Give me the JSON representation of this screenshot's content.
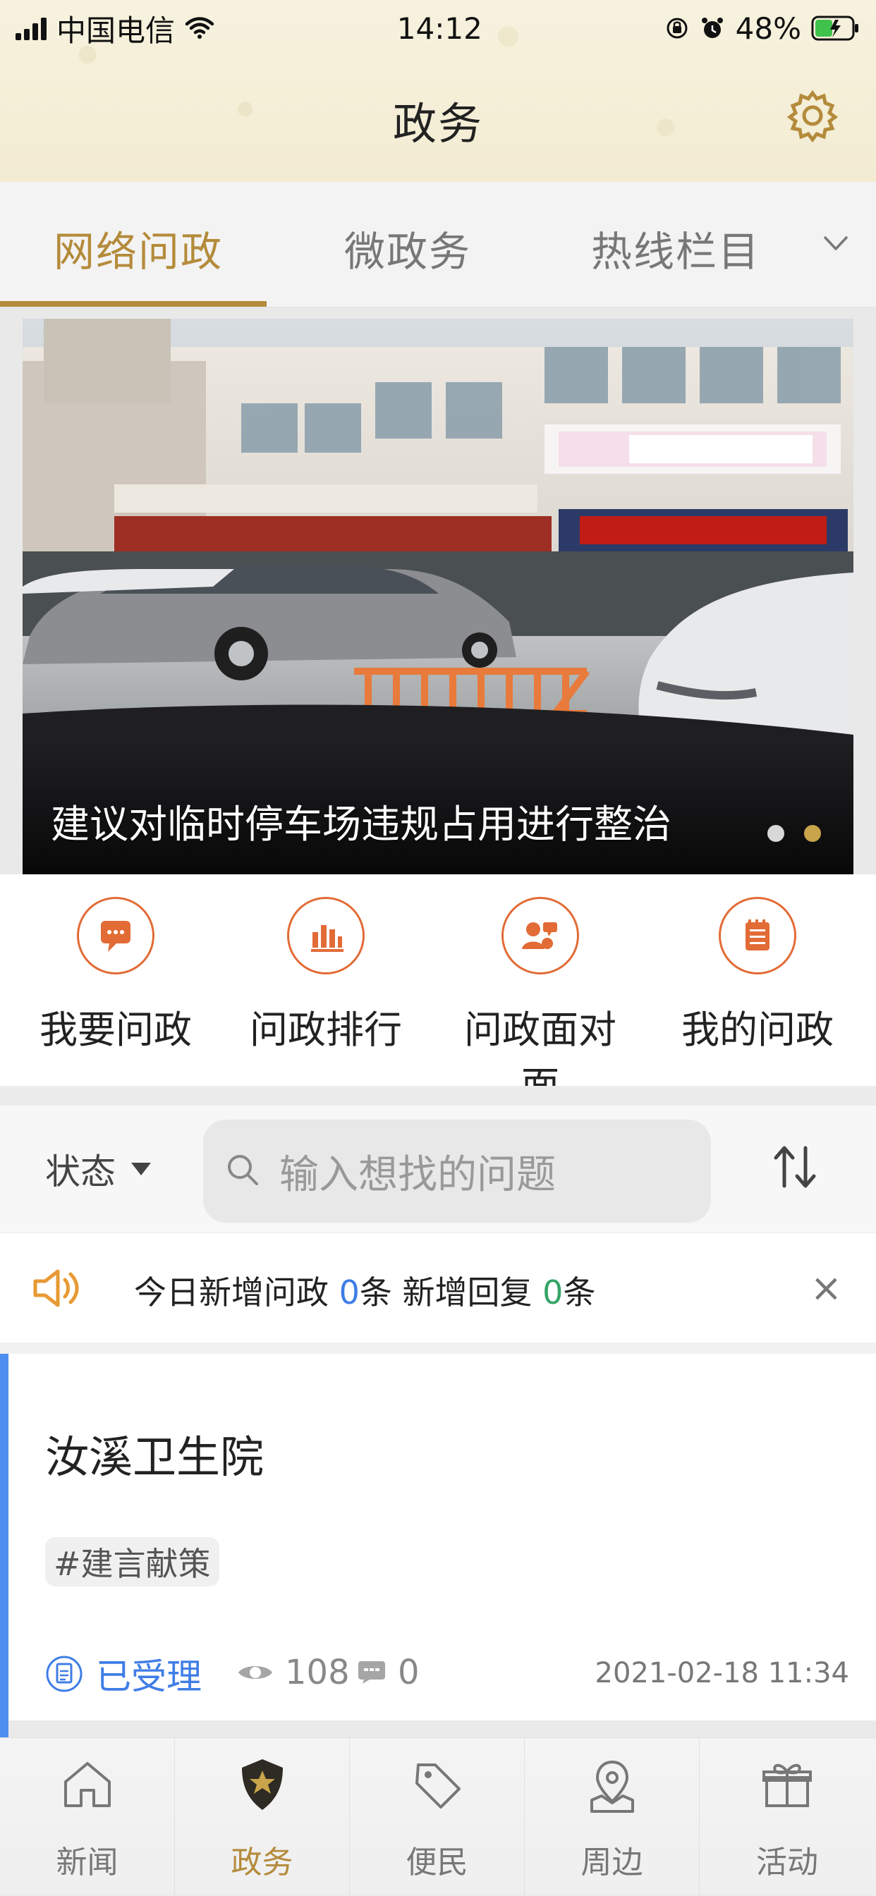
{
  "status_bar": {
    "carrier": "中国电信",
    "time": "14:12",
    "battery": "48%"
  },
  "header": {
    "title": "政务"
  },
  "tabs": [
    {
      "label": "网络问政",
      "active": true
    },
    {
      "label": "微政务",
      "active": false
    },
    {
      "label": "热线栏目",
      "active": false
    }
  ],
  "banner": {
    "caption": "建议对临时停车场违规占用进行整治",
    "page_index": 2,
    "page_count": 2
  },
  "quick_actions": [
    {
      "label": "我要问政",
      "icon": "chat-icon"
    },
    {
      "label": "问政排行",
      "icon": "chart-icon"
    },
    {
      "label": "问政面对面",
      "icon": "face-to-face-icon"
    },
    {
      "label": "我的问政",
      "icon": "notepad-icon"
    }
  ],
  "filter": {
    "status_label": "状态",
    "search_placeholder": "输入想找的问题"
  },
  "notice": {
    "prefix": "今日新增问政 ",
    "new_questions": "0",
    "middle": "条 新增回复 ",
    "new_replies": "0",
    "suffix": "条",
    "close": "×"
  },
  "feed": [
    {
      "title": "汝溪卫生院",
      "tag": "#建言献策",
      "status": "已受理",
      "views": "108",
      "comments": "0",
      "date": "2021-02-18 11:34"
    }
  ],
  "bottom_nav": [
    {
      "label": "新闻",
      "active": false
    },
    {
      "label": "政务",
      "active": true
    },
    {
      "label": "便民",
      "active": false
    },
    {
      "label": "周边",
      "active": false
    },
    {
      "label": "活动",
      "active": false
    }
  ],
  "colors": {
    "accent": "#b48b3b",
    "orange": "#e26b36",
    "blue": "#3f7de6",
    "green": "#35a466"
  }
}
